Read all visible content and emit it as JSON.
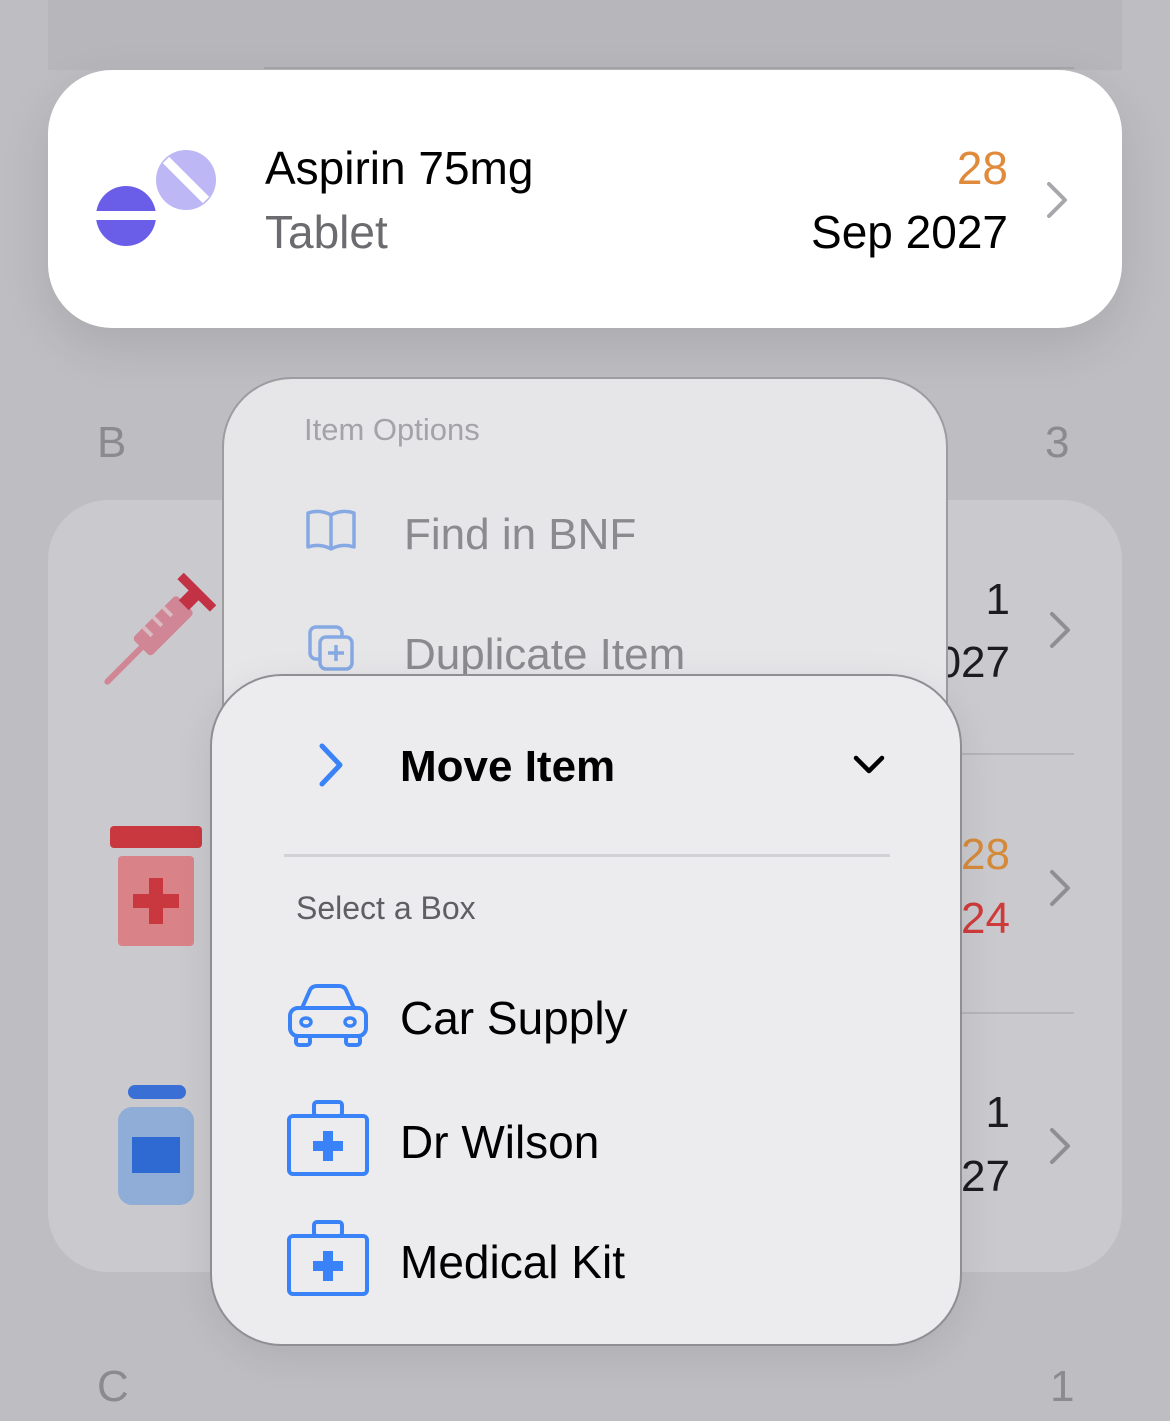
{
  "background": {
    "section_b_letter": "B",
    "section_b_count": "3",
    "section_c_letter": "C",
    "section_c_count": "1",
    "rows": [
      {
        "icon": "syringe-icon",
        "count": "1",
        "date": "027"
      },
      {
        "icon": "medicine-jar-icon",
        "count": "28",
        "date": "24",
        "count_color": "#d58a3a",
        "date_color": "#cf3b3b"
      },
      {
        "icon": "pill-bottle-icon",
        "count": "1",
        "date": "27"
      }
    ]
  },
  "item": {
    "name": "Aspirin 75mg",
    "type": "Tablet",
    "count": "28",
    "expiry": "Sep 2027",
    "icon": "pills-icon",
    "count_color": "#e08a3c",
    "icon_color": "#6a5ee8"
  },
  "menu": {
    "title": "Item Options",
    "items": [
      {
        "label": "Find in BNF",
        "icon": "book-icon"
      },
      {
        "label": "Duplicate Item",
        "icon": "duplicate-icon"
      }
    ]
  },
  "submenu": {
    "title": "Move Item",
    "section_label": "Select a Box",
    "boxes": [
      {
        "label": "Car Supply",
        "icon": "car-icon"
      },
      {
        "label": "Dr Wilson",
        "icon": "medical-case-icon"
      },
      {
        "label": "Medical Kit",
        "icon": "medical-case-icon"
      }
    ],
    "accent": "#3a82f7"
  }
}
